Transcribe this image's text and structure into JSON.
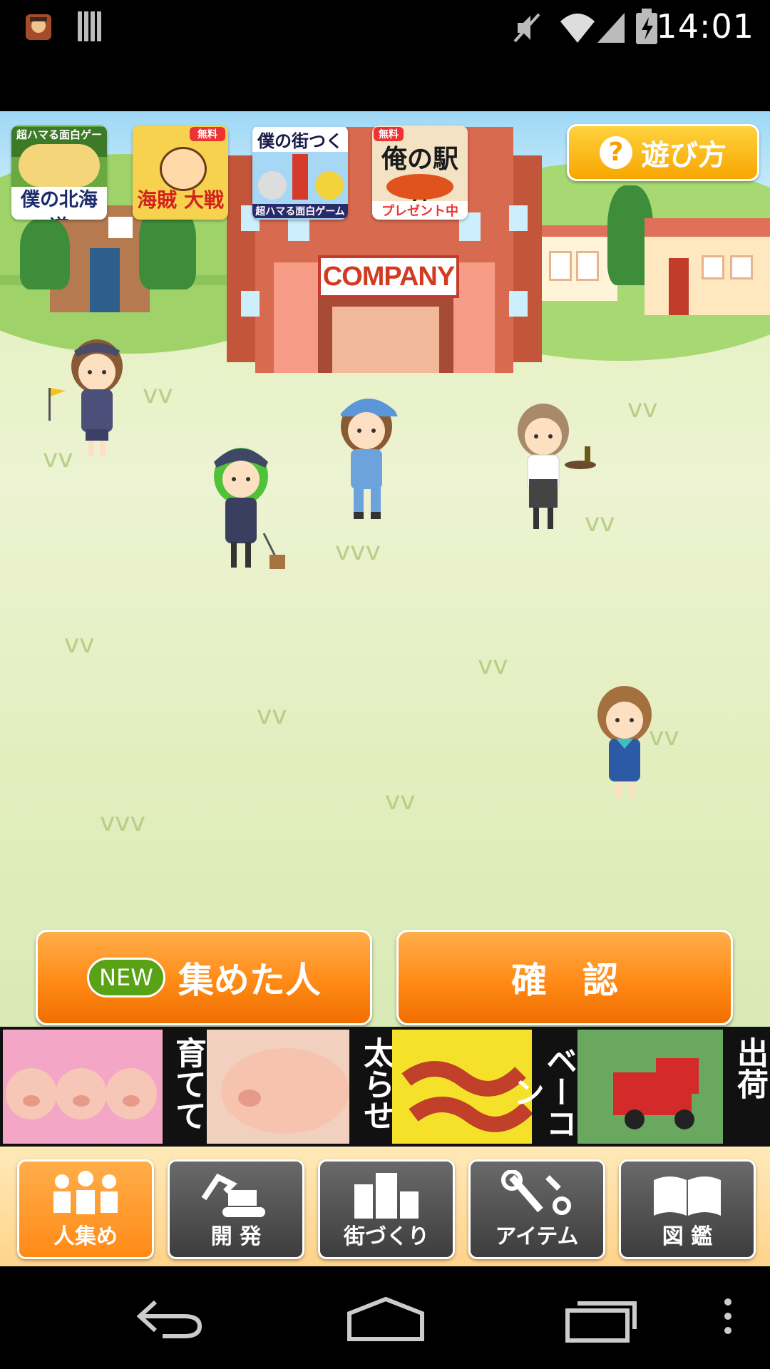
{
  "status_bar": {
    "time": "14:01"
  },
  "promos": [
    {
      "top": "超ハマる面白ゲーム",
      "main": "僕の北海道"
    },
    {
      "top": "無料",
      "main": "海賊 大戦争"
    },
    {
      "top": "僕の街つく",
      "main": "超ハマる面白ゲーム"
    },
    {
      "top": "無料",
      "main": "俺の駅弁",
      "sub": "プレゼント中"
    }
  ],
  "help_button": {
    "label": "遊び方",
    "icon": "question-icon"
  },
  "company_sign": "COMPANY",
  "actions": {
    "new_badge": "NEW",
    "collected_label": "集めた人",
    "confirm_label": "確　認"
  },
  "banner": {
    "words": [
      "育てて",
      "太らせ",
      "ベーコン",
      "出荷"
    ]
  },
  "tabs": [
    {
      "label": "人集め",
      "icon": "people-icon",
      "active": true
    },
    {
      "label": "開 発",
      "icon": "excavator-icon",
      "active": false
    },
    {
      "label": "街づくり",
      "icon": "buildings-icon",
      "active": false
    },
    {
      "label": "アイテム",
      "icon": "tools-icon",
      "active": false
    },
    {
      "label": "図 鑑",
      "icon": "book-icon",
      "active": false
    }
  ],
  "colors": {
    "accent": "#ff8a16",
    "grass": "#e7f1c6",
    "new_badge": "#5aa215"
  }
}
